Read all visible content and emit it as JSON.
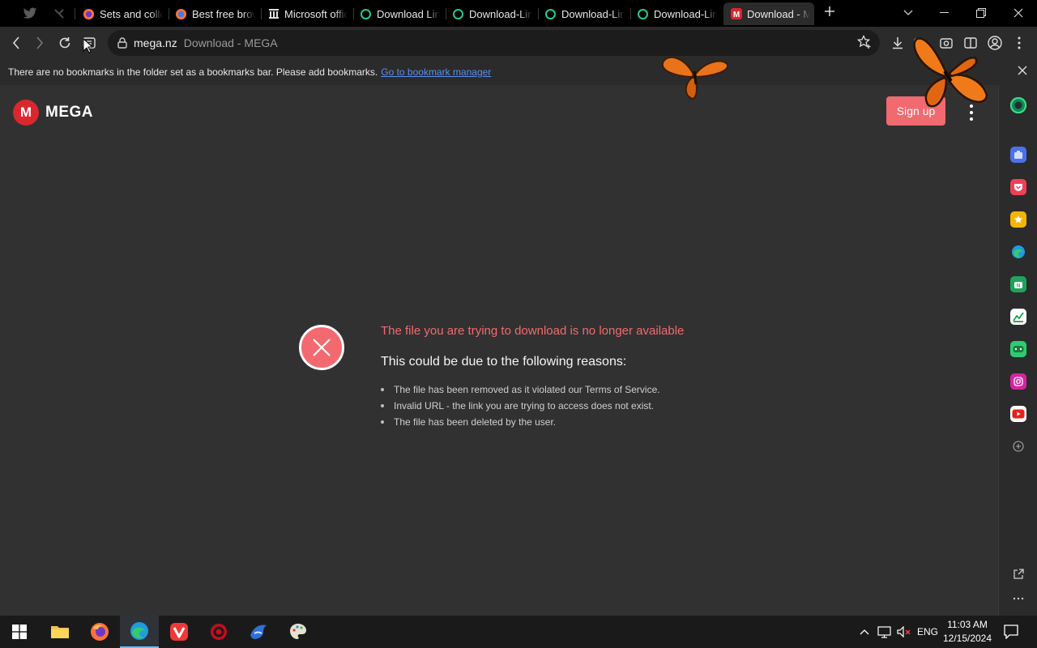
{
  "browser": {
    "tabs": [
      {
        "title": "Sets and collections",
        "favicon": "firefox-icon",
        "active": false
      },
      {
        "title": "Best free browsers",
        "favicon": "firefox-icon",
        "active": false
      },
      {
        "title": "Microsoft office",
        "favicon": "bank-icon",
        "active": false
      },
      {
        "title": "Download Link",
        "favicon": "ring-icon",
        "active": false
      },
      {
        "title": "Download-Link",
        "favicon": "ring-icon",
        "active": false
      },
      {
        "title": "Download-Link",
        "favicon": "ring-icon",
        "active": false
      },
      {
        "title": "Download-Link",
        "favicon": "ring-icon",
        "active": false
      },
      {
        "title": "Download - MEGA",
        "favicon": "mega-icon",
        "active": true
      }
    ],
    "address": {
      "domain": "mega.nz",
      "page_title": "Download - MEGA"
    }
  },
  "bookmarks_bar": {
    "message": "There are no bookmarks in the folder set as a bookmarks bar. Please add bookmarks.",
    "link": "Go to bookmark manager"
  },
  "page": {
    "logo_letter": "M",
    "logo_text": "MEGA",
    "signup_label": "Sign up",
    "error_title": "The file you are trying to download is no longer available",
    "error_subtitle": "This could be due to the following reasons:",
    "reasons": [
      "The file has been removed as it violated our Terms of Service.",
      "Invalid URL - the link you are trying to access does not exist.",
      "The file has been deleted by the user."
    ]
  },
  "taskbar": {
    "language": "ENG",
    "time": "11:03 AM",
    "date": "12/15/2024"
  },
  "colors": {
    "accent_red": "#f26a6f",
    "mega_red": "#d9272e",
    "page_bg": "#313131",
    "link_blue": "#5a8ff0"
  }
}
